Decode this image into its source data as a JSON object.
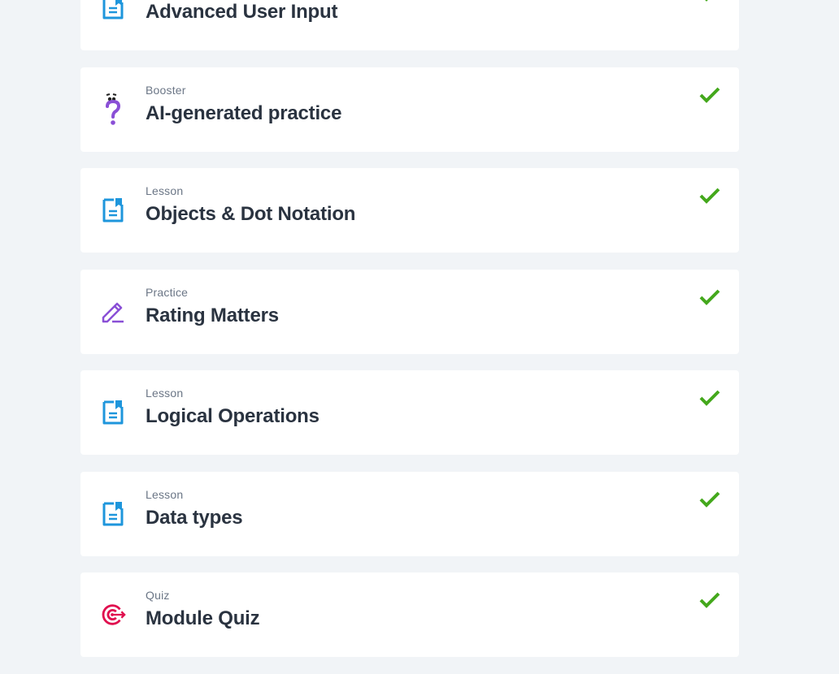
{
  "items": [
    {
      "type": "",
      "title": "Advanced User Input",
      "icon": "lesson-document-icon",
      "completed": true
    },
    {
      "type": "Booster",
      "title": "AI-generated practice",
      "icon": "booster-question-icon",
      "completed": true
    },
    {
      "type": "Lesson",
      "title": "Objects & Dot Notation",
      "icon": "lesson-document-icon",
      "completed": true
    },
    {
      "type": "Practice",
      "title": "Rating Matters",
      "icon": "practice-pencil-icon",
      "completed": true
    },
    {
      "type": "Lesson",
      "title": "Logical Operations",
      "icon": "lesson-document-icon",
      "completed": true
    },
    {
      "type": "Lesson",
      "title": "Data types",
      "icon": "lesson-document-icon",
      "completed": true
    },
    {
      "type": "Quiz",
      "title": "Module Quiz",
      "icon": "quiz-target-icon",
      "completed": true
    }
  ],
  "colors": {
    "lesson": "#1e96dc",
    "booster": "#8a4fd6",
    "practice": "#8a4fd6",
    "quiz": "#e0104f",
    "check": "#44a81c"
  }
}
